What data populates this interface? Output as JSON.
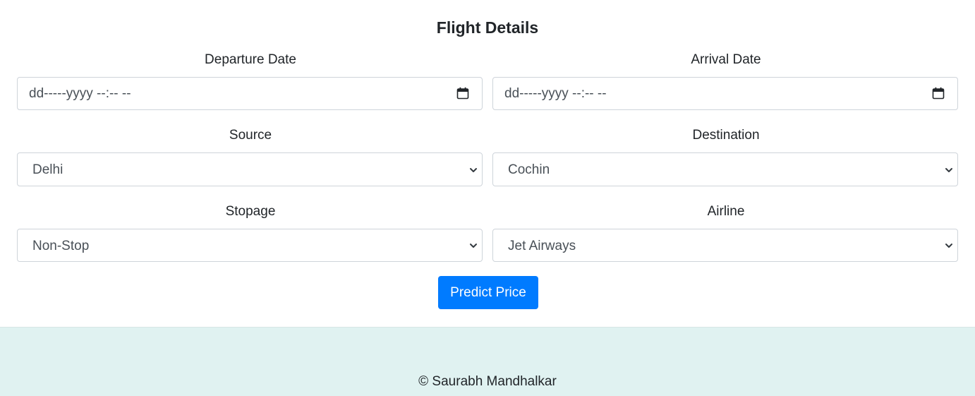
{
  "form": {
    "title": "Flight Details",
    "departure": {
      "label": "Departure Date",
      "placeholder": "dd-----yyyy --:-- --"
    },
    "arrival": {
      "label": "Arrival Date",
      "placeholder": "dd-----yyyy --:-- --"
    },
    "source": {
      "label": "Source",
      "value": "Delhi"
    },
    "destination": {
      "label": "Destination",
      "value": "Cochin"
    },
    "stopage": {
      "label": "Stopage",
      "value": "Non-Stop"
    },
    "airline": {
      "label": "Airline",
      "value": "Jet Airways"
    },
    "submit_label": "Predict Price"
  },
  "footer": {
    "text": "© Saurabh Mandhalkar",
    "background": "#e0f2f1"
  },
  "colors": {
    "primary": "#007bff",
    "border": "#ced4da"
  },
  "icons": {
    "date": "calendar-icon",
    "select": "chevron-down-icon"
  }
}
